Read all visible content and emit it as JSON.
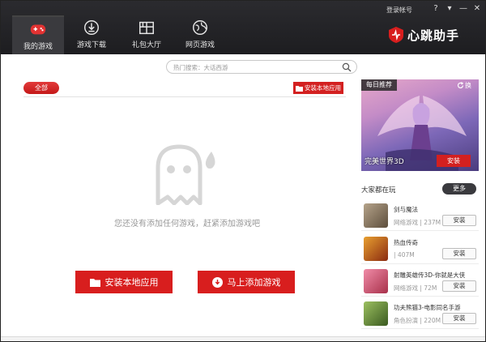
{
  "window": {
    "login_label": "登录帐号",
    "help_label": "?",
    "menu_label": "▾",
    "minimize_label": "—",
    "close_label": "✕"
  },
  "tabs": [
    {
      "label": "我的游戏",
      "icon": "gamepad-icon",
      "active": true
    },
    {
      "label": "游戏下载",
      "icon": "download-icon",
      "active": false
    },
    {
      "label": "礼包大厅",
      "icon": "gift-icon",
      "active": false
    },
    {
      "label": "网页游戏",
      "icon": "globe-icon",
      "active": false
    }
  ],
  "brand": {
    "name": "心跳助手",
    "logo": "heartbeat-logo-icon",
    "accent": "#d81e1e"
  },
  "search": {
    "placeholder": "热门搜索：大话西游"
  },
  "filter": {
    "all_label": "全部",
    "install_local_label": "安装本地应用"
  },
  "empty_state": {
    "icon": "ghost-icon",
    "message": "您还没有添加任何游戏，赶紧添加游戏吧",
    "install_local_label": "安装本地应用",
    "add_game_label": "马上添加游戏"
  },
  "featured": {
    "tag": "每日推荐",
    "refresh_label": "换",
    "title": "完美世界3D",
    "install_label": "安装"
  },
  "playing": {
    "title": "大家都在玩",
    "more_label": "更多",
    "games": [
      {
        "name": "剑与魔法",
        "category": "网络游戏",
        "size": "237M",
        "install_label": "安装",
        "thumb_color": "#8a7a66"
      },
      {
        "name": "热血传奇",
        "category": "",
        "size": "407M",
        "install_label": "安装",
        "thumb_color": "#c0501c"
      },
      {
        "name": "射雕英雄传3D-你就是大侠",
        "category": "网络游戏",
        "size": "72M",
        "install_label": "安装",
        "thumb_color": "#d85a7a"
      },
      {
        "name": "功夫熊猫3-电影同名手游",
        "category": "角色扮演",
        "size": "220M",
        "install_label": "安装",
        "thumb_color": "#6a8a3a"
      }
    ]
  }
}
